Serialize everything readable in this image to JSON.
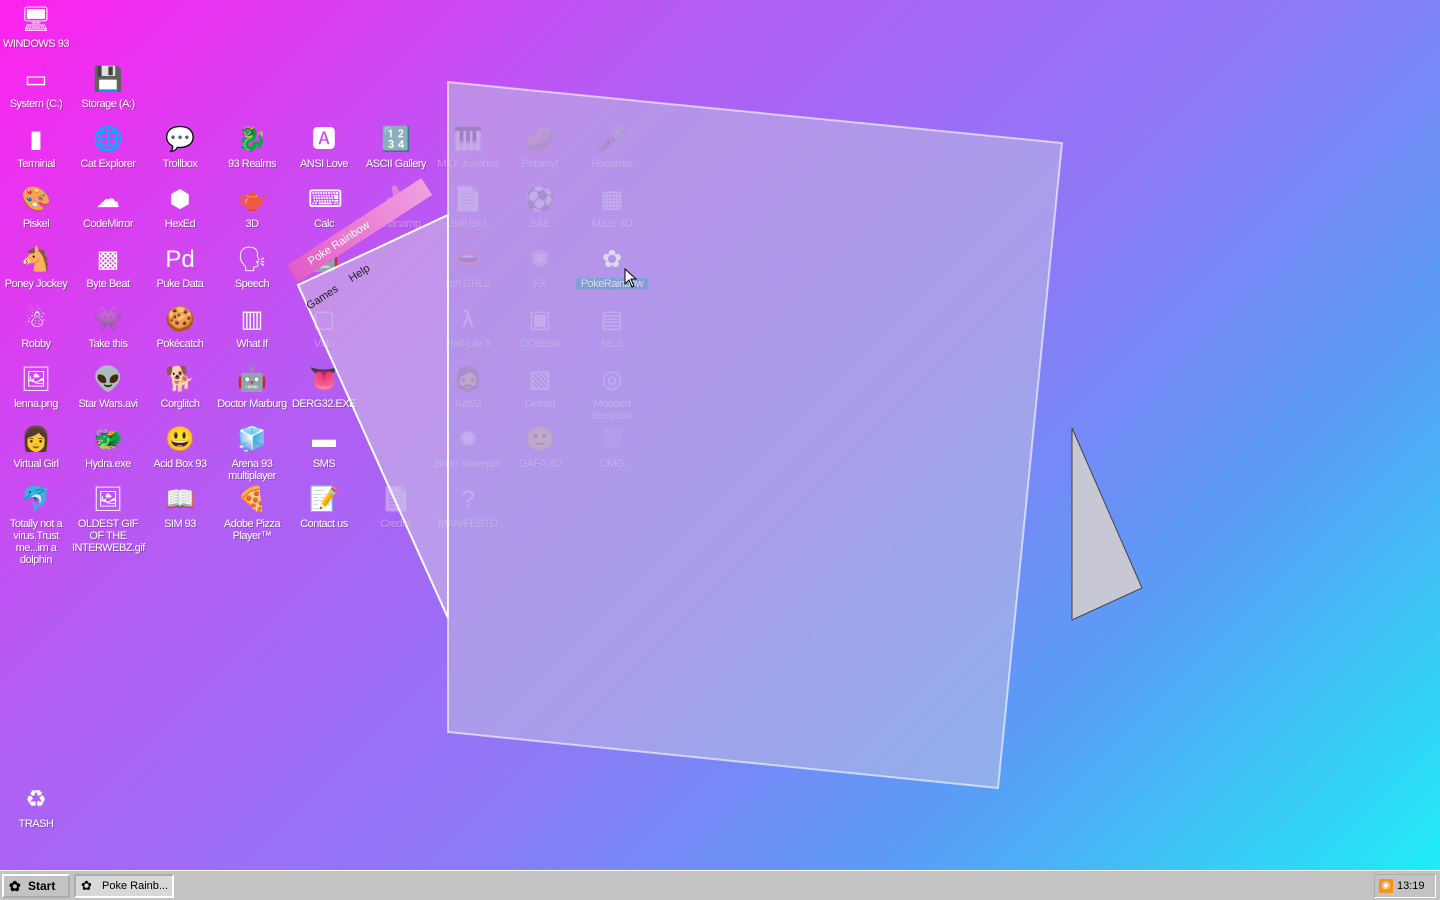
{
  "desktop": {
    "icons": [
      {
        "label": "WINDOWS 93",
        "glyph": "🖥",
        "col": 0,
        "row": 0,
        "faded": false
      },
      {
        "label": "System (C:)",
        "glyph": "▭",
        "col": 0,
        "row": 1,
        "faded": false
      },
      {
        "label": "Storage (A:)",
        "glyph": "💾",
        "col": 1,
        "row": 1,
        "faded": false
      },
      {
        "label": "Terminal",
        "glyph": "▮",
        "col": 0,
        "row": 2,
        "faded": false
      },
      {
        "label": "Cat Explorer",
        "glyph": "🌐",
        "col": 1,
        "row": 2,
        "faded": false
      },
      {
        "label": "Trollbox",
        "glyph": "💬",
        "col": 2,
        "row": 2,
        "faded": false
      },
      {
        "label": "93 Realms",
        "glyph": "🐉",
        "col": 3,
        "row": 2,
        "faded": false
      },
      {
        "label": "ANSI Love",
        "glyph": "🅰",
        "col": 4,
        "row": 2,
        "faded": false
      },
      {
        "label": "ASCII Gallery",
        "glyph": "🔢",
        "col": 5,
        "row": 2,
        "faded": false
      },
      {
        "label": "MIDI Jukebox",
        "glyph": "🎹",
        "col": 6,
        "row": 2,
        "faded": true
      },
      {
        "label": "Potatoyt",
        "glyph": "🥔",
        "col": 7,
        "row": 2,
        "faded": true
      },
      {
        "label": "Recorder",
        "glyph": "🎤",
        "col": 8,
        "row": 2,
        "faded": true
      },
      {
        "label": "Piskel",
        "glyph": "🎨",
        "col": 0,
        "row": 3,
        "faded": false
      },
      {
        "label": "CodeMirror",
        "glyph": "☁",
        "col": 1,
        "row": 3,
        "faded": false
      },
      {
        "label": "HexEd",
        "glyph": "⬢",
        "col": 2,
        "row": 3,
        "faded": false
      },
      {
        "label": "3D",
        "glyph": "🫖",
        "col": 3,
        "row": 3,
        "faded": false
      },
      {
        "label": "Calc",
        "glyph": "⌨",
        "col": 4,
        "row": 3,
        "faded": false
      },
      {
        "label": "Bananamp",
        "glyph": "🍌",
        "col": 5,
        "row": 3,
        "faded": true
      },
      {
        "label": "Sell.ISU",
        "glyph": "📄",
        "col": 6,
        "row": 3,
        "faded": true
      },
      {
        "label": "SAE",
        "glyph": "⚽",
        "col": 7,
        "row": 3,
        "faded": true
      },
      {
        "label": "Maze 3D",
        "glyph": "▦",
        "col": 8,
        "row": 3,
        "faded": true
      },
      {
        "label": "Poney Jockey",
        "glyph": "🐴",
        "col": 0,
        "row": 4,
        "faded": false
      },
      {
        "label": "Byte Beat",
        "glyph": "▩",
        "col": 1,
        "row": 4,
        "faded": false
      },
      {
        "label": "Puke Data",
        "glyph": "Pd",
        "col": 2,
        "row": 4,
        "faded": false
      },
      {
        "label": "Speech",
        "glyph": "🗣",
        "col": 3,
        "row": 4,
        "faded": false
      },
      {
        "label": "",
        "glyph": "🤖",
        "col": 4,
        "row": 4,
        "faded": false
      },
      {
        "label": "itch GRLZ",
        "glyph": "👄",
        "col": 6,
        "row": 4,
        "faded": true
      },
      {
        "label": "FX",
        "glyph": "✺",
        "col": 7,
        "row": 4,
        "faded": true
      },
      {
        "label": "PokeRainbow",
        "glyph": "✿",
        "col": 8,
        "row": 4,
        "faded": false,
        "selected": true
      },
      {
        "label": "Robby",
        "glyph": "☃",
        "col": 0,
        "row": 5,
        "faded": false
      },
      {
        "label": "Take this",
        "glyph": "👾",
        "col": 1,
        "row": 5,
        "faded": false
      },
      {
        "label": "Pokécatch",
        "glyph": "🍪",
        "col": 2,
        "row": 5,
        "faded": false
      },
      {
        "label": "What If",
        "glyph": "▥",
        "col": 3,
        "row": 5,
        "faded": false
      },
      {
        "label": "Virtu",
        "glyph": "▢",
        "col": 4,
        "row": 5,
        "faded": true
      },
      {
        "label": "Half-Life 3",
        "glyph": "λ",
        "col": 6,
        "row": 5,
        "faded": true
      },
      {
        "label": "DOSBox",
        "glyph": "▣",
        "col": 7,
        "row": 5,
        "faded": true
      },
      {
        "label": "NES",
        "glyph": "▤",
        "col": 8,
        "row": 5,
        "faded": true
      },
      {
        "label": "lenna.png",
        "glyph": "🖼",
        "col": 0,
        "row": 6,
        "faded": false
      },
      {
        "label": "Star Wars.avi",
        "glyph": "👽",
        "col": 1,
        "row": 6,
        "faded": false
      },
      {
        "label": "Corglitch",
        "glyph": "🐕",
        "col": 2,
        "row": 6,
        "faded": false
      },
      {
        "label": "Doctor Marburg",
        "glyph": "🤖",
        "col": 3,
        "row": 6,
        "faded": false
      },
      {
        "label": "DERG32.EXE",
        "glyph": "👅",
        "col": 4,
        "row": 6,
        "faded": false
      },
      {
        "label": "Kat93",
        "glyph": "🧔",
        "col": 6,
        "row": 6,
        "faded": true
      },
      {
        "label": "Defrag",
        "glyph": "▧",
        "col": 7,
        "row": 6,
        "faded": true
      },
      {
        "label": "Modded Beepbox",
        "glyph": "◎",
        "col": 8,
        "row": 6,
        "faded": true
      },
      {
        "label": "Virtual Girl",
        "glyph": "👩",
        "col": 0,
        "row": 7,
        "faded": false
      },
      {
        "label": "Hydra.exe",
        "glyph": "🐲",
        "col": 1,
        "row": 7,
        "faded": false
      },
      {
        "label": "Acid Box 93",
        "glyph": "😃",
        "col": 2,
        "row": 7,
        "faded": false
      },
      {
        "label": "Arena 93 multiplayer",
        "glyph": "🧊",
        "col": 3,
        "row": 7,
        "faded": false
      },
      {
        "label": "SMS",
        "glyph": "▬",
        "col": 4,
        "row": 7,
        "faded": false
      },
      {
        "label": "Brian Sweeper",
        "glyph": "✹",
        "col": 6,
        "row": 7,
        "faded": true
      },
      {
        "label": "GAFA 3D",
        "glyph": "🙂",
        "col": 7,
        "row": 7,
        "faded": true
      },
      {
        "label": "DMG",
        "glyph": "⛆",
        "col": 8,
        "row": 7,
        "faded": true
      },
      {
        "label": "Totally not a virus.Trust me...im a dolphin",
        "glyph": "🐬",
        "col": 0,
        "row": 8,
        "faded": false
      },
      {
        "label": "OLDEST GIF OF THE INTERWEBZ.gif",
        "glyph": "🖼",
        "col": 1,
        "row": 8,
        "faded": false
      },
      {
        "label": "SIM 93",
        "glyph": "📖",
        "col": 2,
        "row": 8,
        "faded": false
      },
      {
        "label": "Adobe Pizza Player™",
        "glyph": "🍕",
        "col": 3,
        "row": 8,
        "faded": false
      },
      {
        "label": "Contact us",
        "glyph": "📝",
        "col": 4,
        "row": 8,
        "faded": false
      },
      {
        "label": "Credits",
        "glyph": "📄",
        "col": 5,
        "row": 8,
        "faded": true
      },
      {
        "label": "MANIFESTO",
        "glyph": "?",
        "col": 6,
        "row": 8,
        "faded": true
      }
    ],
    "trash": {
      "label": "TRASH",
      "glyph": "♻"
    }
  },
  "poke_window": {
    "title": "Poke Rainbow",
    "menu": [
      "Games",
      "Help"
    ]
  },
  "taskbar": {
    "start_label": "Start",
    "task_label": "Poke Rainb...",
    "clock": "13:19"
  }
}
